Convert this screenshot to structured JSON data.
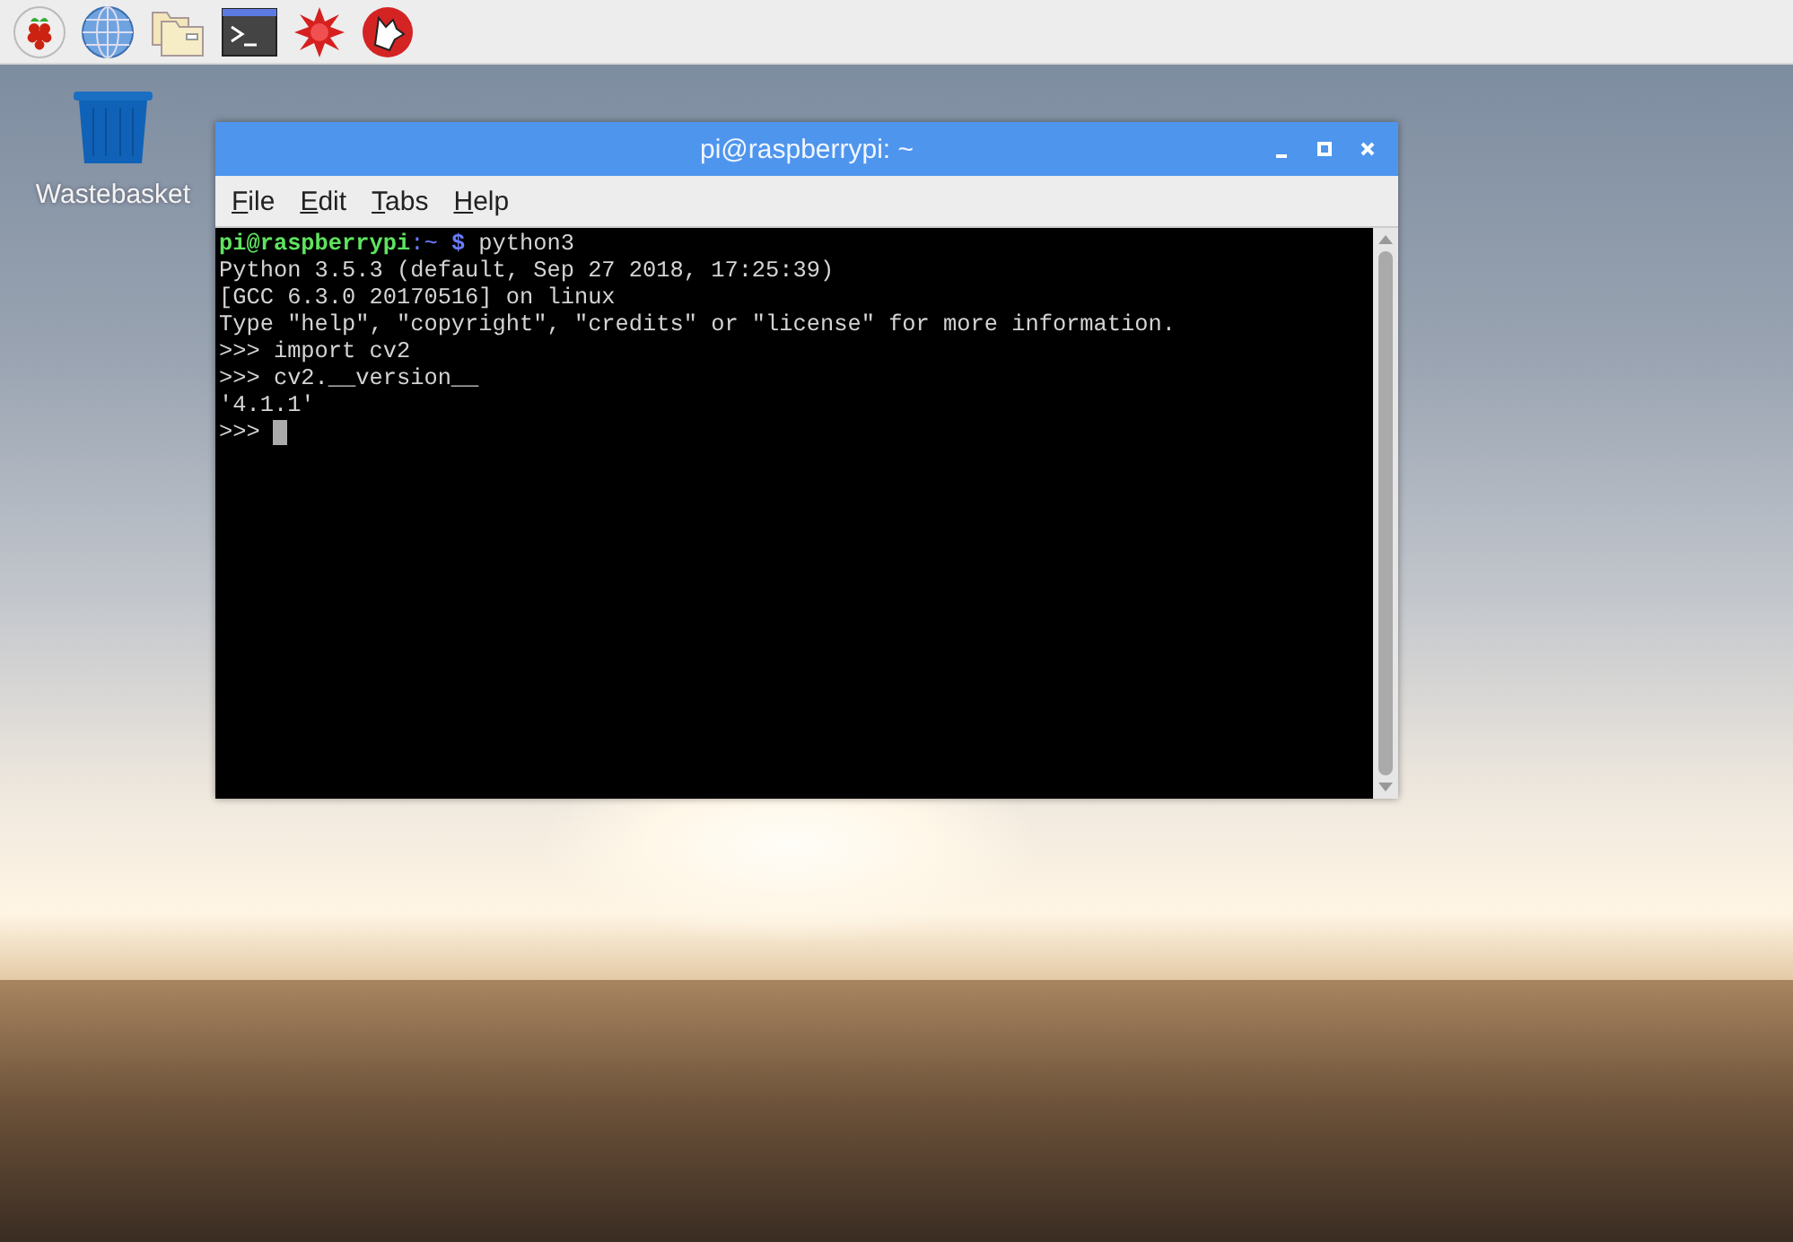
{
  "panel": {
    "launchers": [
      {
        "kind": "raspberry"
      },
      {
        "kind": "globe"
      },
      {
        "kind": "folders"
      },
      {
        "kind": "terminal"
      },
      {
        "kind": "star"
      },
      {
        "kind": "wolf"
      }
    ]
  },
  "desktop": {
    "icons": [
      {
        "label": "Wastebasket"
      }
    ]
  },
  "window": {
    "title": "pi@raspberrypi: ~",
    "active": true,
    "menu": [
      "File",
      "Edit",
      "Tabs",
      "Help"
    ],
    "terminal": {
      "lines": [
        [
          {
            "kind": "user",
            "text": "pi@raspberrypi"
          },
          {
            "kind": "path",
            "text": ":~ "
          },
          {
            "kind": "symbol",
            "text": "$"
          },
          {
            "kind": "text",
            "text": " python3"
          }
        ],
        [
          {
            "kind": "text",
            "text": "Python 3.5.3 (default, Sep 27 2018, 17:25:39)"
          }
        ],
        [
          {
            "kind": "text",
            "text": "[GCC 6.3.0 20170516] on linux"
          }
        ],
        [
          {
            "kind": "text",
            "text": "Type \"help\", \"copyright\", \"credits\" or \"license\" for more information."
          }
        ],
        [
          {
            "kind": "text",
            "text": ">>> import cv2"
          }
        ],
        [
          {
            "kind": "text",
            "text": ">>> cv2.__version__"
          }
        ],
        [
          {
            "kind": "text",
            "text": "'4.1.1'"
          }
        ],
        [
          {
            "kind": "text",
            "text": ">>> "
          },
          {
            "kind": "cursor"
          }
        ]
      ]
    }
  }
}
